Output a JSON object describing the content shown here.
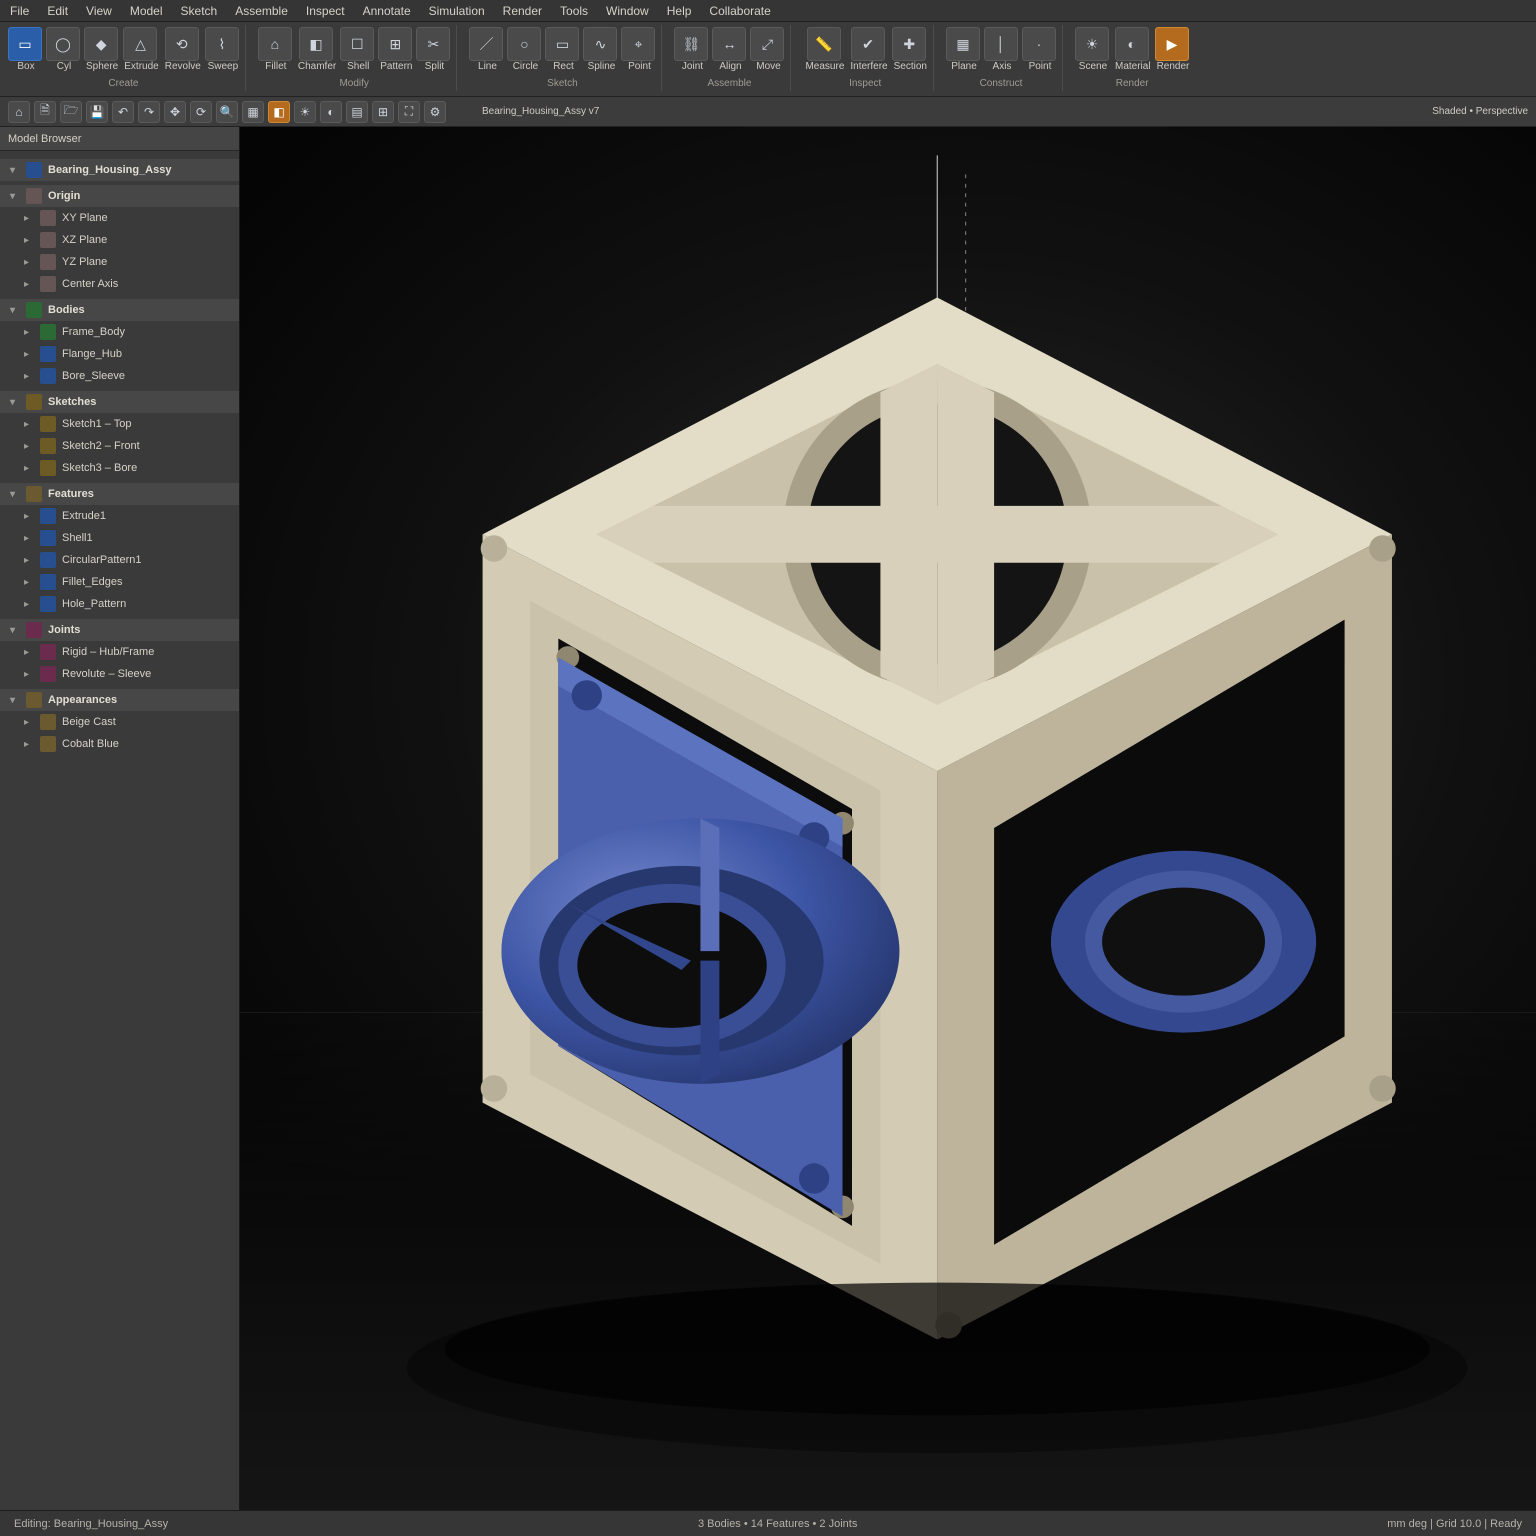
{
  "menubar": [
    "File",
    "Edit",
    "View",
    "Model",
    "Sketch",
    "Assemble",
    "Inspect",
    "Annotate",
    "Simulation",
    "Render",
    "Tools",
    "Window",
    "Help",
    "Collaborate"
  ],
  "ribbon": {
    "groups": [
      {
        "label": "Create",
        "buttons": [
          {
            "glyph": "▭",
            "blue": true,
            "lbl": "Box"
          },
          {
            "glyph": "◯",
            "lbl": "Cyl"
          },
          {
            "glyph": "◆",
            "lbl": "Sphere"
          },
          {
            "glyph": "△",
            "lbl": "Extrude"
          },
          {
            "glyph": "⟲",
            "lbl": "Revolve"
          },
          {
            "glyph": "⌇",
            "lbl": "Sweep"
          }
        ]
      },
      {
        "label": "Modify",
        "buttons": [
          {
            "glyph": "⌂",
            "lbl": "Fillet"
          },
          {
            "glyph": "◧",
            "lbl": "Chamfer"
          },
          {
            "glyph": "☐",
            "lbl": "Shell"
          },
          {
            "glyph": "⊞",
            "lbl": "Pattern"
          },
          {
            "glyph": "✂",
            "lbl": "Split"
          }
        ]
      },
      {
        "label": "Sketch",
        "buttons": [
          {
            "glyph": "／",
            "lbl": "Line"
          },
          {
            "glyph": "○",
            "lbl": "Circle"
          },
          {
            "glyph": "▭",
            "lbl": "Rect"
          },
          {
            "glyph": "∿",
            "lbl": "Spline"
          },
          {
            "glyph": "⌖",
            "lbl": "Point"
          }
        ]
      },
      {
        "label": "Assemble",
        "buttons": [
          {
            "glyph": "⛓",
            "lbl": "Joint"
          },
          {
            "glyph": "↔",
            "lbl": "Align"
          },
          {
            "glyph": "⤢",
            "lbl": "Move"
          }
        ]
      },
      {
        "label": "Inspect",
        "buttons": [
          {
            "glyph": "📏",
            "lbl": "Measure"
          },
          {
            "glyph": "✔",
            "lbl": "Interfere"
          },
          {
            "glyph": "✚",
            "lbl": "Section"
          }
        ]
      },
      {
        "label": "Construct",
        "buttons": [
          {
            "glyph": "▦",
            "lbl": "Plane"
          },
          {
            "glyph": "│",
            "lbl": "Axis"
          },
          {
            "glyph": "·",
            "lbl": "Point"
          }
        ]
      },
      {
        "label": "Render",
        "buttons": [
          {
            "glyph": "☀",
            "lbl": "Scene"
          },
          {
            "glyph": "◐",
            "lbl": "Material"
          },
          {
            "glyph": "▶",
            "orange": true,
            "lbl": "Render"
          }
        ]
      }
    ]
  },
  "strip": {
    "items": [
      {
        "glyph": "⌂"
      },
      {
        "glyph": "🗎"
      },
      {
        "glyph": "🗁"
      },
      {
        "glyph": "💾"
      },
      {
        "glyph": "↶"
      },
      {
        "glyph": "↷"
      },
      {
        "glyph": "✥"
      },
      {
        "glyph": "⟳"
      },
      {
        "glyph": "🔍"
      },
      {
        "glyph": "▦"
      },
      {
        "glyph": "◧",
        "orange": true
      },
      {
        "glyph": "☀"
      },
      {
        "glyph": "◐"
      },
      {
        "glyph": "▤"
      },
      {
        "glyph": "⊞"
      },
      {
        "glyph": "⛶"
      },
      {
        "glyph": "⚙"
      }
    ],
    "doc_label": "Bearing_Housing_Assy v7",
    "view_label": "Shaded • Perspective"
  },
  "browser": {
    "header": "Model Browser",
    "root": "Bearing_Housing_Assy",
    "sections": [
      {
        "title": "Origin",
        "icon": "origin",
        "children": [
          {
            "label": "XY Plane",
            "icon": "origin"
          },
          {
            "label": "XZ Plane",
            "icon": "origin"
          },
          {
            "label": "YZ Plane",
            "icon": "origin"
          },
          {
            "label": "Center Axis",
            "icon": "origin"
          }
        ]
      },
      {
        "title": "Bodies",
        "icon": "body",
        "children": [
          {
            "label": "Frame_Body",
            "icon": "body"
          },
          {
            "label": "Flange_Hub",
            "icon": "part"
          },
          {
            "label": "Bore_Sleeve",
            "icon": "part"
          }
        ]
      },
      {
        "title": "Sketches",
        "icon": "sketch",
        "children": [
          {
            "label": "Sketch1 – Top",
            "icon": "sketch"
          },
          {
            "label": "Sketch2 – Front",
            "icon": "sketch"
          },
          {
            "label": "Sketch3 – Bore",
            "icon": "sketch"
          }
        ]
      },
      {
        "title": "Features",
        "icon": "folder",
        "children": [
          {
            "label": "Extrude1",
            "icon": "part"
          },
          {
            "label": "Shell1",
            "icon": "part"
          },
          {
            "label": "CircularPattern1",
            "icon": "part"
          },
          {
            "label": "Fillet_Edges",
            "icon": "part"
          },
          {
            "label": "Hole_Pattern",
            "icon": "part"
          }
        ]
      },
      {
        "title": "Joints",
        "icon": "joint",
        "children": [
          {
            "label": "Rigid – Hub/Frame",
            "icon": "joint"
          },
          {
            "label": "Revolute – Sleeve",
            "icon": "joint"
          }
        ]
      },
      {
        "title": "Appearances",
        "icon": "folder",
        "children": [
          {
            "label": "Beige Cast",
            "icon": "folder"
          },
          {
            "label": "Cobalt Blue",
            "icon": "folder"
          }
        ]
      }
    ]
  },
  "status": {
    "left": "Editing: Bearing_Housing_Assy",
    "mid": "3 Bodies  •  14 Features  •  2 Joints",
    "right": "mm  deg   |   Grid 10.0   |   Ready"
  },
  "colors": {
    "frame": "#d8d0bb",
    "frame_shadow": "#b7ae97",
    "frame_dark": "#8f876f",
    "hub": "#3d55a5",
    "hub_mid": "#2e4184",
    "hub_dark": "#1f2d5e"
  }
}
